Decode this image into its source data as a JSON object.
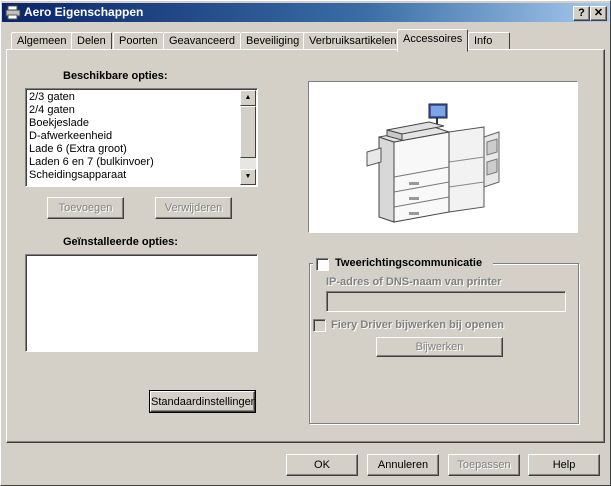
{
  "window": {
    "title": "Aero Eigenschappen"
  },
  "caption_buttons": {
    "help": "?",
    "close": "✕"
  },
  "tabs": [
    {
      "label": "Algemeen"
    },
    {
      "label": "Delen"
    },
    {
      "label": "Poorten"
    },
    {
      "label": "Geavanceerd"
    },
    {
      "label": "Beveiliging"
    },
    {
      "label": "Verbruiksartikelen"
    },
    {
      "label": "Accessoires",
      "active": true
    },
    {
      "label": "Info"
    }
  ],
  "available": {
    "label": "Beschikbare opties:",
    "items": [
      "2/3 gaten",
      "2/4 gaten",
      "Boekjeslade",
      "D-afwerkeenheid",
      "Lade 6 (Extra groot)",
      "Laden 6 en 7 (bulkinvoer)",
      "Scheidingsapparaat"
    ]
  },
  "buttons": {
    "add": "Toevoegen",
    "remove": "Verwijderen",
    "defaults": "Standaardinstellingen",
    "update": "Bijwerken",
    "ok": "OK",
    "cancel": "Annuleren",
    "apply": "Toepassen",
    "help": "Help"
  },
  "installed": {
    "label": "Geïnstalleerde opties:"
  },
  "bidirectional": {
    "label": "Tweerichtingscommunicatie",
    "checked": false,
    "ip_label": "IP-adres of DNS-naam van printer",
    "ip_value": "",
    "fiery_label": "Fiery Driver bijwerken bij openen"
  },
  "icons": {
    "scroll_up": "▲",
    "scroll_down": "▼"
  },
  "colors": {
    "face": "#d4d0c8",
    "title_start": "#0a246a",
    "title_end": "#a6caf0"
  }
}
